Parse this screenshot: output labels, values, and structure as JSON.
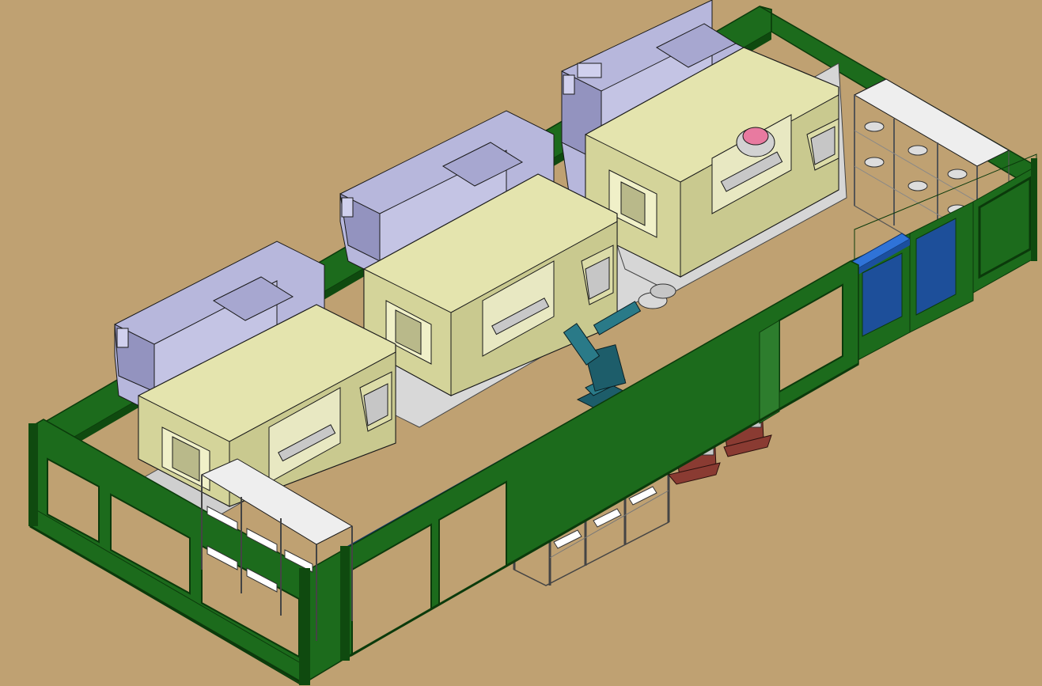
{
  "scene": {
    "kind": "isometric CAD rendering of a robotic machining cell",
    "colors": {
      "background": "#bfa172",
      "fence_frame": "#1c6b1c",
      "fence_dark": "#0f4a0f",
      "fence_panel": "#2d7d2d",
      "machine_body": "#e4e4ae",
      "machine_shade": "#c9c98f",
      "control_cabinet": "#b7b7dc",
      "control_shade": "#9393bf",
      "metal": "#d2d2d2",
      "rack_frame": "#eeeeee",
      "rail": "#2f73d8",
      "robot": "#1d5d6a",
      "stand_brown": "#8a3b32",
      "door_blue": "#1d4f9a",
      "outline": "#1a1a1a"
    },
    "machines": [
      {
        "id": "cnc-1",
        "icon": "cnc-machining-center-icon"
      },
      {
        "id": "cnc-2",
        "icon": "cnc-machining-center-icon"
      },
      {
        "id": "cnc-3",
        "icon": "cnc-machining-center-icon"
      }
    ],
    "robot": {
      "icon": "industrial-robot-arm-icon"
    },
    "rail": {
      "icon": "linear-track-icon"
    },
    "racks": [
      {
        "id": "rack-left",
        "icon": "storage-rack-icon"
      },
      {
        "id": "rack-center",
        "icon": "storage-rack-icon"
      },
      {
        "id": "rack-right",
        "icon": "storage-rack-icon"
      }
    ],
    "stands": [
      {
        "id": "stand-1",
        "icon": "cylinder-fixture-stand-icon"
      },
      {
        "id": "stand-2",
        "icon": "cylinder-fixture-stand-icon"
      }
    ],
    "fence": {
      "icon": "safety-fence-icon"
    }
  }
}
